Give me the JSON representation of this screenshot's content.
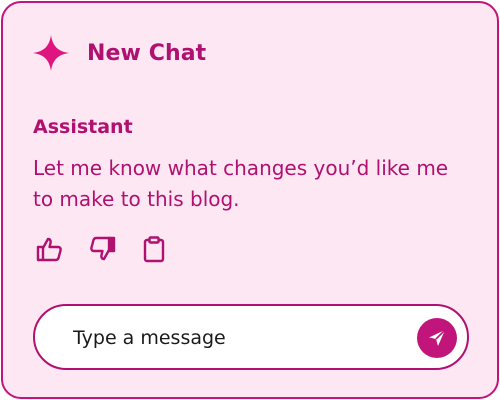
{
  "header": {
    "title": "New Chat",
    "icon": "sparkle-icon"
  },
  "message": {
    "sender": "Assistant",
    "text": "Let me know what changes you’d like me to make to this blog."
  },
  "actions": [
    {
      "name": "thumbs-up-icon"
    },
    {
      "name": "thumbs-down-icon"
    },
    {
      "name": "clipboard-icon"
    }
  ],
  "composer": {
    "placeholder": "Type a message",
    "send_icon": "send-icon"
  },
  "colors": {
    "accent": "#c2157c",
    "text": "#b0106f",
    "background": "#fde7f2",
    "input_background": "#ffffff"
  }
}
